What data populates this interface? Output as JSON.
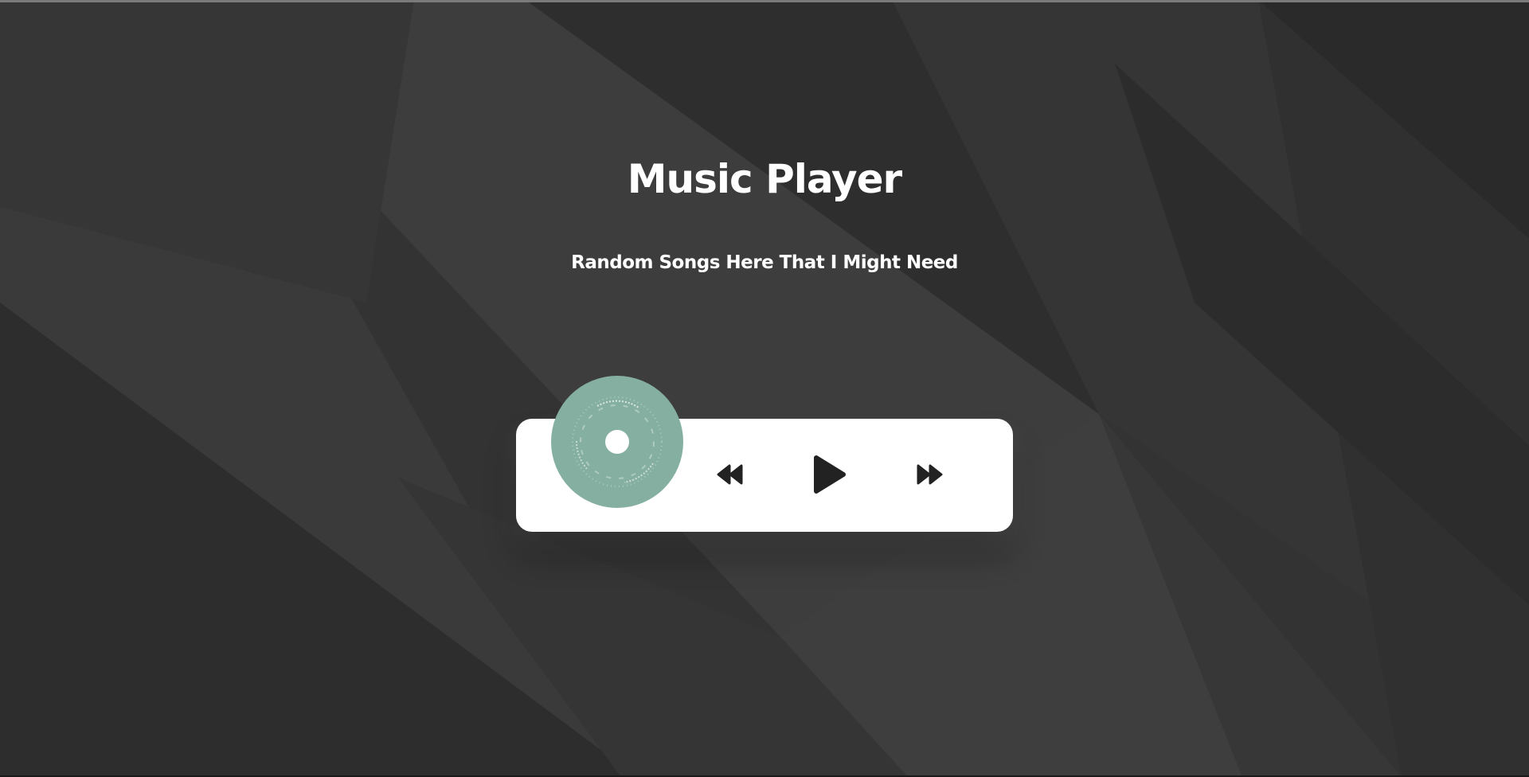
{
  "page": {
    "title": "Music Player",
    "subtitle": "Random Songs Here That I Might Need"
  },
  "player": {
    "disc_color": "#85b0a1",
    "controls": [
      {
        "name": "previous",
        "icon": "rewind-icon"
      },
      {
        "name": "play",
        "icon": "play-icon"
      },
      {
        "name": "next",
        "icon": "fast-forward-icon"
      }
    ]
  },
  "colors": {
    "background": "#323232",
    "card": "#ffffff",
    "icon": "#222222",
    "text": "#ffffff"
  }
}
